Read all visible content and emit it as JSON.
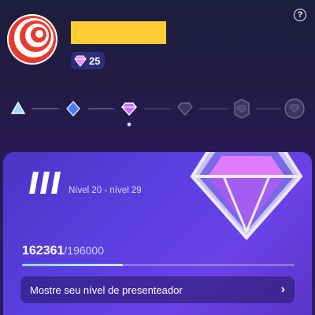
{
  "header": {
    "help_icon": "question-circle-icon",
    "help_glyph": "?",
    "avatar_icon": "red-white-concentric-target",
    "name_placeholder_color": "#ffcc33",
    "gem_icon": "pink-diamond-icon",
    "gem_count": "25"
  },
  "level_track": {
    "stages": [
      {
        "icon": "light-blue-diamond-icon",
        "state": "unlocked"
      },
      {
        "icon": "blue-diamond-icon",
        "state": "unlocked"
      },
      {
        "icon": "pink-diamond-icon",
        "state": "current"
      },
      {
        "icon": "dark-diamond-icon",
        "state": "locked"
      },
      {
        "icon": "dark-badge-icon",
        "state": "locked"
      },
      {
        "icon": "dark-emblem-icon",
        "state": "locked"
      }
    ]
  },
  "level_card": {
    "tier_numeral": "III",
    "level_range": "Nível 20 - nível 29",
    "badge_icon": "large-purple-diamond-icon",
    "progress_current": "162361",
    "progress_separator": "/",
    "progress_max": "196000",
    "progress_fraction": 0.37,
    "cta_label": "Mostre seu nível de presenteador",
    "cta_icon": "chevron-right-icon",
    "cta_glyph": "›"
  },
  "colors": {
    "background": "#221b45",
    "card": "#5b3fe0",
    "name_bar": "#ffcc33",
    "progress_fill": "#a8dcff"
  }
}
